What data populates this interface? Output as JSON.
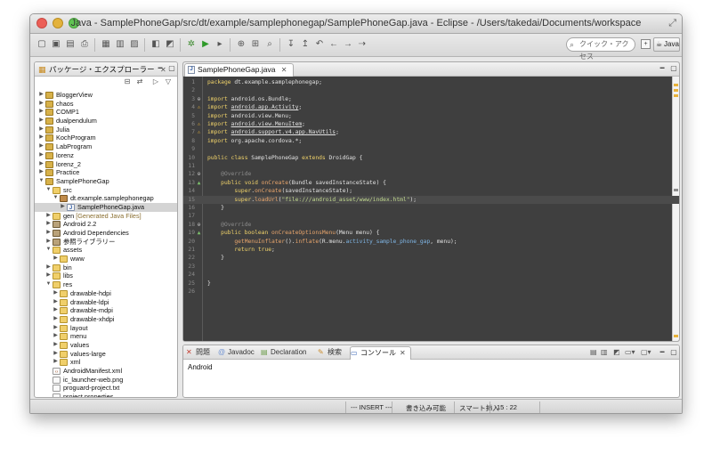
{
  "window": {
    "title": "Java - SamplePhoneGap/src/dt/example/samplephonegap/SamplePhoneGap.java - Eclipse - /Users/takedai/Documents/workspace"
  },
  "toolbar": {
    "quick_access_placeholder": "クイック・アクセス",
    "perspective_label": "Java"
  },
  "package_explorer": {
    "title": "パッケージ・エクスプローラー",
    "close": "✕",
    "tree": [
      {
        "label": "BloggerView",
        "level": 0,
        "icon": "project",
        "twisty": "closed"
      },
      {
        "label": "chaos",
        "level": 0,
        "icon": "project",
        "twisty": "closed"
      },
      {
        "label": "COMP1",
        "level": 0,
        "icon": "project",
        "twisty": "closed"
      },
      {
        "label": "dualpendulum",
        "level": 0,
        "icon": "project",
        "twisty": "closed"
      },
      {
        "label": "Julia",
        "level": 0,
        "icon": "project",
        "twisty": "closed"
      },
      {
        "label": "KochProgram",
        "level": 0,
        "icon": "project",
        "twisty": "closed"
      },
      {
        "label": "LabProgram",
        "level": 0,
        "icon": "project",
        "twisty": "closed"
      },
      {
        "label": "lorenz",
        "level": 0,
        "icon": "project",
        "twisty": "closed"
      },
      {
        "label": "lorenz_2",
        "level": 0,
        "icon": "project",
        "twisty": "closed"
      },
      {
        "label": "Practice",
        "level": 0,
        "icon": "project",
        "twisty": "closed"
      },
      {
        "label": "SamplePhoneGap",
        "level": 0,
        "icon": "project",
        "twisty": "open"
      },
      {
        "label": "src",
        "level": 1,
        "icon": "src",
        "twisty": "open"
      },
      {
        "label": "dt.example.samplephonegap",
        "level": 2,
        "icon": "package",
        "twisty": "open"
      },
      {
        "label": "SamplePhoneGap.java",
        "level": 3,
        "icon": "java",
        "twisty": "closed",
        "selected": true
      },
      {
        "label": "gen",
        "note": "[Generated Java Files]",
        "level": 1,
        "icon": "src",
        "twisty": "closed"
      },
      {
        "label": "Android 2.2",
        "level": 1,
        "icon": "lib",
        "twisty": "closed"
      },
      {
        "label": "Android Dependencies",
        "level": 1,
        "icon": "lib",
        "twisty": "closed"
      },
      {
        "label": "参照ライブラリー",
        "level": 1,
        "icon": "lib",
        "twisty": "closed"
      },
      {
        "label": "assets",
        "level": 1,
        "icon": "folder",
        "twisty": "open"
      },
      {
        "label": "www",
        "level": 2,
        "icon": "folder",
        "twisty": "closed"
      },
      {
        "label": "bin",
        "level": 1,
        "icon": "folder",
        "twisty": "closed"
      },
      {
        "label": "libs",
        "level": 1,
        "icon": "folder",
        "twisty": "closed"
      },
      {
        "label": "res",
        "level": 1,
        "icon": "folder",
        "twisty": "open"
      },
      {
        "label": "drawable-hdpi",
        "level": 2,
        "icon": "folder",
        "twisty": "closed"
      },
      {
        "label": "drawable-ldpi",
        "level": 2,
        "icon": "folder",
        "twisty": "closed"
      },
      {
        "label": "drawable-mdpi",
        "level": 2,
        "icon": "folder",
        "twisty": "closed"
      },
      {
        "label": "drawable-xhdpi",
        "level": 2,
        "icon": "folder",
        "twisty": "closed"
      },
      {
        "label": "layout",
        "level": 2,
        "icon": "folder",
        "twisty": "closed"
      },
      {
        "label": "menu",
        "level": 2,
        "icon": "folder",
        "twisty": "closed"
      },
      {
        "label": "values",
        "level": 2,
        "icon": "folder",
        "twisty": "closed"
      },
      {
        "label": "values-large",
        "level": 2,
        "icon": "folder",
        "twisty": "closed"
      },
      {
        "label": "xml",
        "level": 2,
        "icon": "folder",
        "twisty": "closed"
      },
      {
        "label": "AndroidManifest.xml",
        "level": 1,
        "icon": "xml",
        "twisty": "none"
      },
      {
        "label": "ic_launcher-web.png",
        "level": 1,
        "icon": "file",
        "twisty": "none"
      },
      {
        "label": "proguard-project.txt",
        "level": 1,
        "icon": "file",
        "twisty": "none"
      },
      {
        "label": "project.properties",
        "level": 1,
        "icon": "file",
        "twisty": "none"
      }
    ]
  },
  "editor": {
    "tab_label": "SamplePhoneGap.java",
    "close": "✕",
    "current_line": 15,
    "lines": [
      {
        "n": "1",
        "tokens": [
          [
            "kw",
            "package"
          ],
          [
            "t",
            " dt.example.samplephonegap;"
          ]
        ]
      },
      {
        "n": "2",
        "tokens": []
      },
      {
        "n": "3",
        "marker": "fold",
        "tokens": [
          [
            "kw",
            "import"
          ],
          [
            "t",
            " android.os.Bundle;"
          ]
        ]
      },
      {
        "n": "4",
        "marker": "warn",
        "tokens": [
          [
            "kw",
            "import"
          ],
          [
            "t",
            " "
          ],
          [
            "ul",
            "android.app.Activity"
          ],
          [
            "t",
            ";"
          ]
        ]
      },
      {
        "n": "5",
        "tokens": [
          [
            "kw",
            "import"
          ],
          [
            "t",
            " android.view.Menu;"
          ]
        ]
      },
      {
        "n": "6",
        "marker": "warn",
        "tokens": [
          [
            "kw",
            "import"
          ],
          [
            "t",
            " "
          ],
          [
            "ul",
            "android.view.MenuItem"
          ],
          [
            "t",
            ";"
          ]
        ]
      },
      {
        "n": "7",
        "marker": "warn",
        "tokens": [
          [
            "kw",
            "import"
          ],
          [
            "t",
            " "
          ],
          [
            "ul",
            "android.support.v4.app.NavUtils"
          ],
          [
            "t",
            ";"
          ]
        ]
      },
      {
        "n": "8",
        "tokens": [
          [
            "kw",
            "import"
          ],
          [
            "t",
            " org.apache.cordova.*;"
          ]
        ]
      },
      {
        "n": "9",
        "tokens": []
      },
      {
        "n": "10",
        "tokens": [
          [
            "kw",
            "public class"
          ],
          [
            "t",
            " SamplePhoneGap "
          ],
          [
            "kw",
            "extends"
          ],
          [
            "t",
            " DroidGap {"
          ]
        ]
      },
      {
        "n": "11",
        "tokens": []
      },
      {
        "n": "12",
        "marker": "fold",
        "tokens": [
          [
            "t",
            "    "
          ],
          [
            "ann",
            "@Override"
          ]
        ]
      },
      {
        "n": "13",
        "marker": "up",
        "tokens": [
          [
            "t",
            "    "
          ],
          [
            "kw",
            "public void"
          ],
          [
            "t",
            " "
          ],
          [
            "mth",
            "onCreate"
          ],
          [
            "t",
            "(Bundle savedInstanceState) {"
          ]
        ]
      },
      {
        "n": "14",
        "tokens": [
          [
            "t",
            "        "
          ],
          [
            "kw",
            "super"
          ],
          [
            "t",
            "."
          ],
          [
            "mth",
            "onCreate"
          ],
          [
            "t",
            "(savedInstanceState);"
          ]
        ]
      },
      {
        "n": "15",
        "tokens": [
          [
            "t",
            "        "
          ],
          [
            "kw",
            "super"
          ],
          [
            "t",
            "."
          ],
          [
            "mth",
            "loadUrl"
          ],
          [
            "t",
            "("
          ],
          [
            "str",
            "\"file:///android_asset/www/index.html\""
          ],
          [
            "t",
            ");"
          ]
        ]
      },
      {
        "n": "16",
        "tokens": [
          [
            "t",
            "    }"
          ]
        ]
      },
      {
        "n": "17",
        "tokens": []
      },
      {
        "n": "18",
        "marker": "fold",
        "tokens": [
          [
            "t",
            "    "
          ],
          [
            "ann",
            "@Override"
          ]
        ]
      },
      {
        "n": "19",
        "marker": "up",
        "tokens": [
          [
            "t",
            "    "
          ],
          [
            "kw",
            "public boolean"
          ],
          [
            "t",
            " "
          ],
          [
            "mth",
            "onCreateOptionsMenu"
          ],
          [
            "t",
            "(Menu menu) {"
          ]
        ]
      },
      {
        "n": "20",
        "tokens": [
          [
            "t",
            "        "
          ],
          [
            "mth",
            "getMenuInflater"
          ],
          [
            "t",
            "()."
          ],
          [
            "mth",
            "inflate"
          ],
          [
            "t",
            "(R.menu."
          ],
          [
            "fld",
            "activity_sample_phone_gap"
          ],
          [
            "t",
            ", menu);"
          ]
        ]
      },
      {
        "n": "21",
        "tokens": [
          [
            "t",
            "        "
          ],
          [
            "kw",
            "return true"
          ],
          [
            "t",
            ";"
          ]
        ]
      },
      {
        "n": "22",
        "tokens": [
          [
            "t",
            "    }"
          ]
        ]
      },
      {
        "n": "23",
        "tokens": []
      },
      {
        "n": "24",
        "tokens": []
      },
      {
        "n": "25",
        "tokens": [
          [
            "t",
            "}"
          ]
        ]
      },
      {
        "n": "26",
        "tokens": []
      }
    ]
  },
  "bottom_panel": {
    "tabs": [
      {
        "label": "問題",
        "icon": "problems-icon",
        "glyph": "✕",
        "color": "#c23b2e"
      },
      {
        "label": "Javadoc",
        "icon": "javadoc-icon",
        "glyph": "@",
        "color": "#6b8fd1"
      },
      {
        "label": "Declaration",
        "icon": "declaration-icon",
        "glyph": "▤",
        "color": "#6b9c4a"
      },
      {
        "label": "検索",
        "icon": "search-icon",
        "glyph": "✎",
        "color": "#c98a2a"
      },
      {
        "label": "コンソール",
        "icon": "console-icon",
        "glyph": "▭",
        "color": "#3a66b5",
        "active": true
      }
    ],
    "close": "✕",
    "console_text": "Android"
  },
  "status_bar": {
    "insert_mode": "--- INSERT ---",
    "writable": "書き込み可能",
    "smart_insert": "スマート挿入",
    "position": "15 : 22"
  },
  "colors": {
    "editor_bg": "#3f3f3f",
    "keyword": "#f1d36a",
    "string": "#c0d88e",
    "method": "#e8a56c",
    "field": "#7fb6e6",
    "annotation": "#8b8b8b"
  }
}
